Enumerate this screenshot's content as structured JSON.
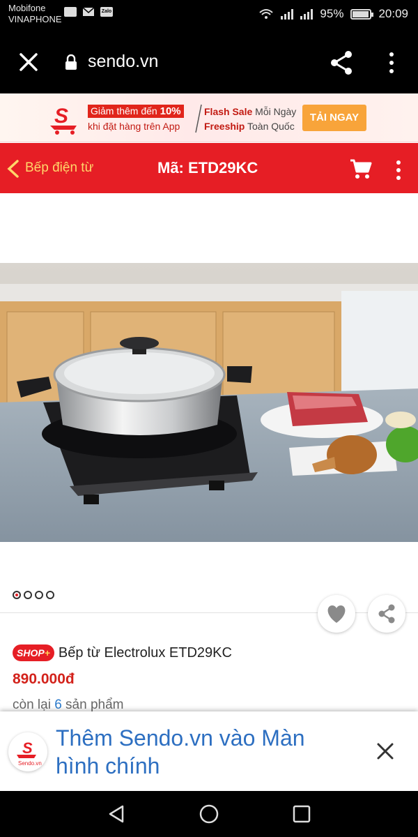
{
  "status": {
    "carrier1": "Mobifone",
    "carrier2": "VINAPHONE",
    "zalo_label": "Zalo",
    "battery": "95%",
    "time": "20:09"
  },
  "browser": {
    "url": "sendo.vn"
  },
  "promo": {
    "line1_prefix": "Giảm thêm đến ",
    "line1_pct": "10%",
    "line2": "khi đặt hàng trên App",
    "flash_bold": "Flash Sale",
    "flash_rest": " Mỗi Ngày",
    "ship_bold": "Freeship",
    "ship_rest": " Toàn Quốc",
    "button": "TẢI NGAY"
  },
  "header": {
    "back_label": "Bếp điện từ",
    "title": "Mã: ETD29KC"
  },
  "gallery": {
    "image_count": 4,
    "active_index": 0
  },
  "product": {
    "badge_text": "SHOP",
    "badge_plus": "+",
    "title": "Bếp từ Electrolux ETD29KC",
    "price": "890.000đ",
    "stock_prefix": "còn lại ",
    "stock_count": "6",
    "stock_suffix": " sản phẩm"
  },
  "add_to_home": {
    "text": "Thêm Sendo.vn vào Màn hình chính",
    "logo_caption": "Sendo.vn"
  },
  "colors": {
    "brand_red": "#e61e25",
    "link_blue": "#2d6fc1",
    "promo_button": "#f8a43a"
  }
}
